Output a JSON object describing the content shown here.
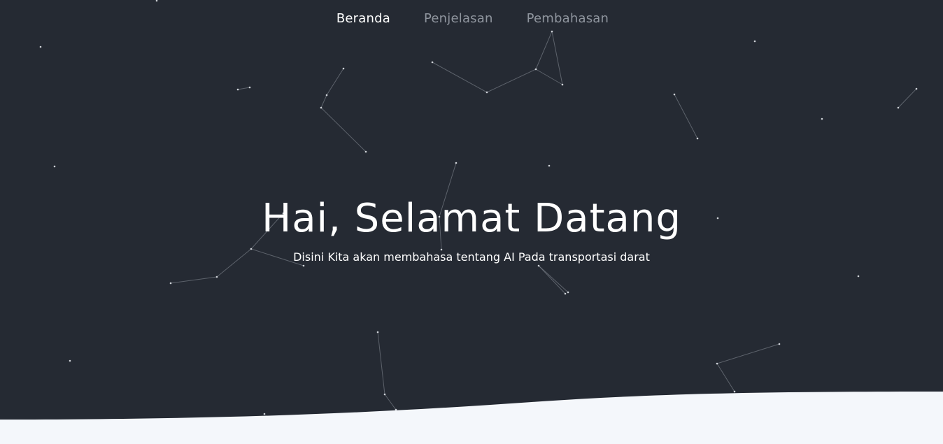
{
  "nav": {
    "items": [
      {
        "label": "Beranda",
        "active": true
      },
      {
        "label": "Penjelasan",
        "active": false
      },
      {
        "label": "Pembahasan",
        "active": false
      }
    ]
  },
  "hero": {
    "title": "Hai, Selamat Datang",
    "subtitle": "Disini Kita akan membahasa tentang AI Pada transportasi darat"
  },
  "colors": {
    "background": "#252a33",
    "wave": "#f4f7fb",
    "nav_active": "#ffffff",
    "nav_inactive": "#8f959e",
    "particle": "#cfd3d8"
  },
  "background_effect": "particle-network"
}
